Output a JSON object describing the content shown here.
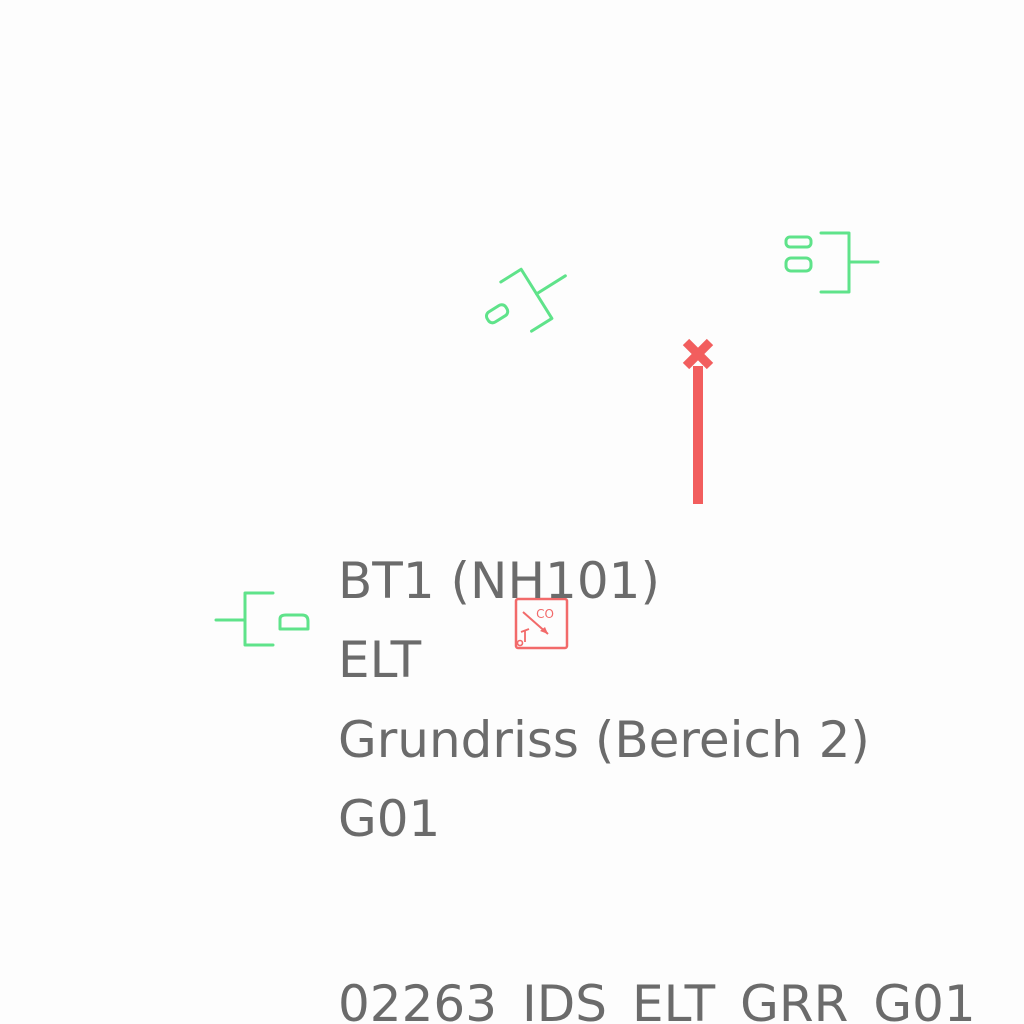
{
  "colors": {
    "background": "#fdfdfd",
    "text": "#6b6b6b",
    "fixture_symbol": "#5fe38a",
    "detector_symbol": "#f26a6a",
    "marker_line": "#f25e5e"
  },
  "icons": {
    "fixture_symbol": "wall-fixture-icon",
    "detector_symbol": "co-detector-icon",
    "marker": "x-marker-icon"
  },
  "detector": {
    "label": "CO"
  },
  "title_block": {
    "project": "BT1 (NH101)",
    "discipline": "ELT",
    "drawing": "Grundriss (Bereich 2)",
    "level": "G01",
    "document_number": "02263_IDS_ELT_GRR_G01"
  }
}
